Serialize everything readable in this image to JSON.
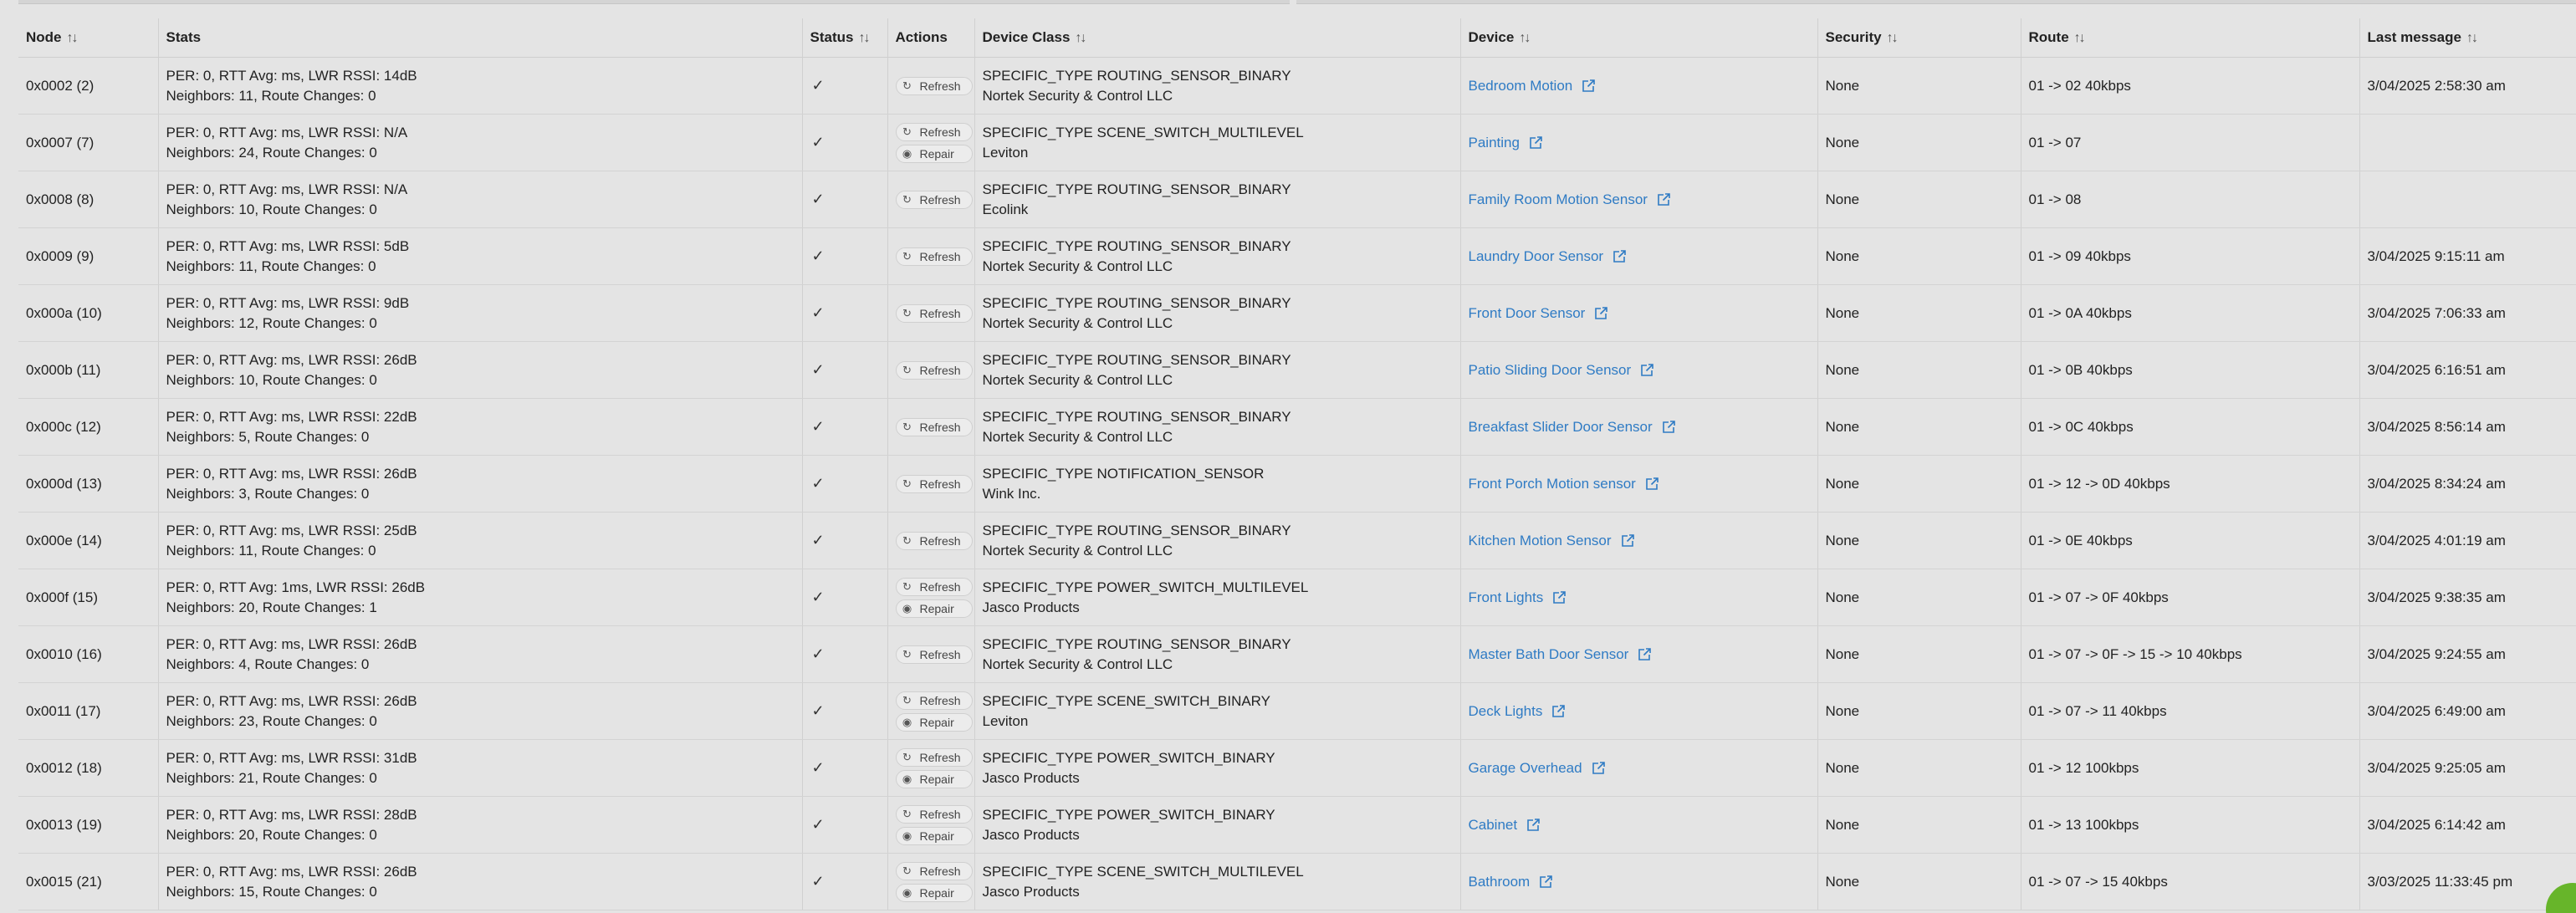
{
  "columns": [
    {
      "label": "Node",
      "sortable": true
    },
    {
      "label": "Stats",
      "sortable": false
    },
    {
      "label": "Status",
      "sortable": true
    },
    {
      "label": "Actions",
      "sortable": false
    },
    {
      "label": "Device Class",
      "sortable": true
    },
    {
      "label": "Device",
      "sortable": true
    },
    {
      "label": "Security",
      "sortable": true
    },
    {
      "label": "Route",
      "sortable": true
    },
    {
      "label": "Last message",
      "sortable": true
    }
  ],
  "sort_glyph": "↑↓",
  "status_glyph": "✓",
  "actions": {
    "refresh_label": "Refresh",
    "repair_label": "Repair"
  },
  "link_color": "#2f7bc4",
  "rows": [
    {
      "node": "0x0002 (2)",
      "stats1": "PER: 0, RTT Avg: ms, LWR RSSI: 14dB",
      "stats2": "Neighbors: 11, Route Changes: 0",
      "repair": false,
      "class1": "SPECIFIC_TYPE ROUTING_SENSOR_BINARY",
      "class2": "Nortek Security & Control LLC",
      "device": "Bedroom Motion",
      "security": "None",
      "route": "01 -> 02 40kbps",
      "last": "3/04/2025 2:58:30 am"
    },
    {
      "node": "0x0007 (7)",
      "stats1": "PER: 0, RTT Avg: ms, LWR RSSI: N/A",
      "stats2": "Neighbors: 24, Route Changes: 0",
      "repair": true,
      "class1": "SPECIFIC_TYPE SCENE_SWITCH_MULTILEVEL",
      "class2": "Leviton",
      "device": "Painting",
      "security": "None",
      "route": "01 -> 07",
      "last": ""
    },
    {
      "node": "0x0008 (8)",
      "stats1": "PER: 0, RTT Avg: ms, LWR RSSI: N/A",
      "stats2": "Neighbors: 10, Route Changes: 0",
      "repair": false,
      "class1": "SPECIFIC_TYPE ROUTING_SENSOR_BINARY",
      "class2": "Ecolink",
      "device": "Family Room Motion Sensor",
      "security": "None",
      "route": "01 -> 08",
      "last": ""
    },
    {
      "node": "0x0009 (9)",
      "stats1": "PER: 0, RTT Avg: ms, LWR RSSI: 5dB",
      "stats2": "Neighbors: 11, Route Changes: 0",
      "repair": false,
      "class1": "SPECIFIC_TYPE ROUTING_SENSOR_BINARY",
      "class2": "Nortek Security & Control LLC",
      "device": "Laundry Door Sensor",
      "security": "None",
      "route": "01 -> 09 40kbps",
      "last": "3/04/2025 9:15:11 am"
    },
    {
      "node": "0x000a (10)",
      "stats1": "PER: 0, RTT Avg: ms, LWR RSSI: 9dB",
      "stats2": "Neighbors: 12, Route Changes: 0",
      "repair": false,
      "class1": "SPECIFIC_TYPE ROUTING_SENSOR_BINARY",
      "class2": "Nortek Security & Control LLC",
      "device": "Front Door Sensor",
      "security": "None",
      "route": "01 -> 0A 40kbps",
      "last": "3/04/2025 7:06:33 am"
    },
    {
      "node": "0x000b (11)",
      "stats1": "PER: 0, RTT Avg: ms, LWR RSSI: 26dB",
      "stats2": "Neighbors: 10, Route Changes: 0",
      "repair": false,
      "class1": "SPECIFIC_TYPE ROUTING_SENSOR_BINARY",
      "class2": "Nortek Security & Control LLC",
      "device": "Patio Sliding Door Sensor",
      "security": "None",
      "route": "01 -> 0B 40kbps",
      "last": "3/04/2025 6:16:51 am"
    },
    {
      "node": "0x000c (12)",
      "stats1": "PER: 0, RTT Avg: ms, LWR RSSI: 22dB",
      "stats2": "Neighbors: 5, Route Changes: 0",
      "repair": false,
      "class1": "SPECIFIC_TYPE ROUTING_SENSOR_BINARY",
      "class2": "Nortek Security & Control LLC",
      "device": "Breakfast Slider Door Sensor",
      "security": "None",
      "route": "01 -> 0C 40kbps",
      "last": "3/04/2025 8:56:14 am"
    },
    {
      "node": "0x000d (13)",
      "stats1": "PER: 0, RTT Avg: ms, LWR RSSI: 26dB",
      "stats2": "Neighbors: 3, Route Changes: 0",
      "repair": false,
      "class1": "SPECIFIC_TYPE NOTIFICATION_SENSOR",
      "class2": "Wink Inc.",
      "device": "Front Porch Motion sensor",
      "security": "None",
      "route": "01 -> 12 -> 0D 40kbps",
      "last": "3/04/2025 8:34:24 am"
    },
    {
      "node": "0x000e (14)",
      "stats1": "PER: 0, RTT Avg: ms, LWR RSSI: 25dB",
      "stats2": "Neighbors: 11, Route Changes: 0",
      "repair": false,
      "class1": "SPECIFIC_TYPE ROUTING_SENSOR_BINARY",
      "class2": "Nortek Security & Control LLC",
      "device": "Kitchen Motion Sensor",
      "security": "None",
      "route": "01 -> 0E 40kbps",
      "last": "3/04/2025 4:01:19 am"
    },
    {
      "node": "0x000f (15)",
      "stats1": "PER: 0, RTT Avg: 1ms, LWR RSSI: 26dB",
      "stats2": "Neighbors: 20, Route Changes: 1",
      "repair": true,
      "class1": "SPECIFIC_TYPE POWER_SWITCH_MULTILEVEL",
      "class2": "Jasco Products",
      "device": "Front Lights",
      "security": "None",
      "route": "01 -> 07 -> 0F 40kbps",
      "last": "3/04/2025 9:38:35 am"
    },
    {
      "node": "0x0010 (16)",
      "stats1": "PER: 0, RTT Avg: ms, LWR RSSI: 26dB",
      "stats2": "Neighbors: 4, Route Changes: 0",
      "repair": false,
      "class1": "SPECIFIC_TYPE ROUTING_SENSOR_BINARY",
      "class2": "Nortek Security & Control LLC",
      "device": "Master Bath Door Sensor",
      "security": "None",
      "route": "01 -> 07 -> 0F -> 15 -> 10 40kbps",
      "last": "3/04/2025 9:24:55 am"
    },
    {
      "node": "0x0011 (17)",
      "stats1": "PER: 0, RTT Avg: ms, LWR RSSI: 26dB",
      "stats2": "Neighbors: 23, Route Changes: 0",
      "repair": true,
      "class1": "SPECIFIC_TYPE SCENE_SWITCH_BINARY",
      "class2": "Leviton",
      "device": "Deck Lights",
      "security": "None",
      "route": "01 -> 07 -> 11 40kbps",
      "last": "3/04/2025 6:49:00 am"
    },
    {
      "node": "0x0012 (18)",
      "stats1": "PER: 0, RTT Avg: ms, LWR RSSI: 31dB",
      "stats2": "Neighbors: 21, Route Changes: 0",
      "repair": true,
      "class1": "SPECIFIC_TYPE POWER_SWITCH_BINARY",
      "class2": "Jasco Products",
      "device": "Garage Overhead",
      "security": "None",
      "route": "01 -> 12 100kbps",
      "last": "3/04/2025 9:25:05 am"
    },
    {
      "node": "0x0013 (19)",
      "stats1": "PER: 0, RTT Avg: ms, LWR RSSI: 28dB",
      "stats2": "Neighbors: 20, Route Changes: 0",
      "repair": true,
      "class1": "SPECIFIC_TYPE POWER_SWITCH_BINARY",
      "class2": "Jasco Products",
      "device": "Cabinet",
      "security": "None",
      "route": "01 -> 13 100kbps",
      "last": "3/04/2025 6:14:42 am"
    },
    {
      "node": "0x0015 (21)",
      "stats1": "PER: 0, RTT Avg: ms, LWR RSSI: 26dB",
      "stats2": "Neighbors: 15, Route Changes: 0",
      "repair": true,
      "class1": "SPECIFIC_TYPE SCENE_SWITCH_MULTILEVEL",
      "class2": "Jasco Products",
      "device": "Bathroom",
      "security": "None",
      "route": "01 -> 07 -> 15 40kbps",
      "last": "3/03/2025 11:33:45 pm"
    }
  ]
}
